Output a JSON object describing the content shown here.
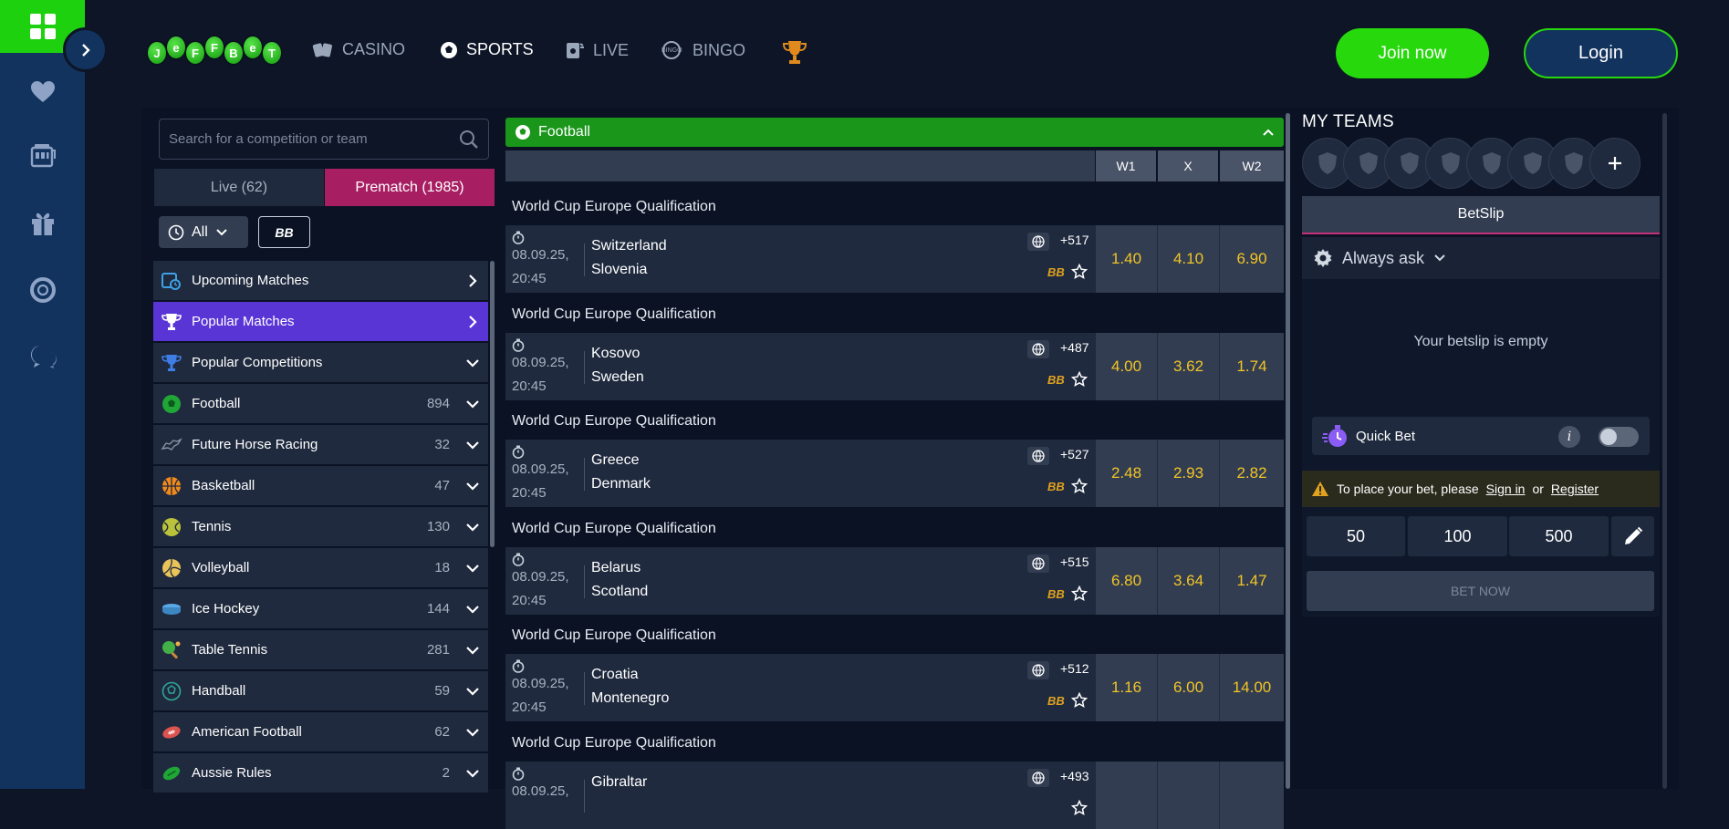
{
  "brand": {
    "logo_letters": [
      "J",
      "e",
      "F",
      "F",
      "B",
      "e",
      "T"
    ]
  },
  "nav": [
    {
      "label": "CASINO",
      "icon": "cards-icon",
      "active": false
    },
    {
      "label": "SPORTS",
      "icon": "soccer-ball-icon",
      "active": true
    },
    {
      "label": "LIVE",
      "icon": "live-icon",
      "active": false
    },
    {
      "label": "BINGO",
      "icon": "bingo-icon",
      "active": false
    },
    {
      "label": "",
      "icon": "trophy-icon",
      "active": false
    }
  ],
  "auth": {
    "join_label": "Join now",
    "login_label": "Login"
  },
  "sidebar": {
    "search_placeholder": "Search for a competition or team",
    "tabs": {
      "live": "Live (62)",
      "prematch": "Prematch (1985)"
    },
    "filter_all": "All",
    "filter_bb": "BB",
    "items": [
      {
        "label": "Upcoming Matches",
        "count": "",
        "icon": "calendar-clock-icon",
        "chevron": "right",
        "active": false
      },
      {
        "label": "Popular Matches",
        "count": "",
        "icon": "trophy-icon",
        "chevron": "right",
        "active": true
      },
      {
        "label": "Popular Competitions",
        "count": "",
        "icon": "cup-icon",
        "chevron": "down",
        "active": false
      },
      {
        "label": "Football",
        "count": "894",
        "icon": "football-icon",
        "chevron": "down",
        "active": false
      },
      {
        "label": "Future Horse Racing",
        "count": "32",
        "icon": "horse-icon",
        "chevron": "down",
        "active": false
      },
      {
        "label": "Basketball",
        "count": "47",
        "icon": "basketball-icon",
        "chevron": "down",
        "active": false
      },
      {
        "label": "Tennis",
        "count": "130",
        "icon": "tennis-icon",
        "chevron": "down",
        "active": false
      },
      {
        "label": "Volleyball",
        "count": "18",
        "icon": "volleyball-icon",
        "chevron": "down",
        "active": false
      },
      {
        "label": "Ice Hockey",
        "count": "144",
        "icon": "puck-icon",
        "chevron": "down",
        "active": false
      },
      {
        "label": "Table Tennis",
        "count": "281",
        "icon": "table-tennis-icon",
        "chevron": "down",
        "active": false
      },
      {
        "label": "Handball",
        "count": "59",
        "icon": "handball-icon",
        "chevron": "down",
        "active": false
      },
      {
        "label": "American Football",
        "count": "62",
        "icon": "american-football-icon",
        "chevron": "down",
        "active": false
      },
      {
        "label": "Aussie Rules",
        "count": "2",
        "icon": "aussie-rules-icon",
        "chevron": "down",
        "active": false
      }
    ]
  },
  "center": {
    "sport": "Football",
    "columns": [
      "W1",
      "X",
      "W2"
    ],
    "matches": [
      {
        "competition": "World Cup Europe Qualification",
        "date": "08.09.25,",
        "time": "20:45",
        "home": "Switzerland",
        "away": "Slovenia",
        "more": "+517",
        "bb": "BB",
        "odds": [
          "1.40",
          "4.10",
          "6.90"
        ]
      },
      {
        "competition": "World Cup Europe Qualification",
        "date": "08.09.25,",
        "time": "20:45",
        "home": "Kosovo",
        "away": "Sweden",
        "more": "+487",
        "bb": "BB",
        "odds": [
          "4.00",
          "3.62",
          "1.74"
        ]
      },
      {
        "competition": "World Cup Europe Qualification",
        "date": "08.09.25,",
        "time": "20:45",
        "home": "Greece",
        "away": "Denmark",
        "more": "+527",
        "bb": "BB",
        "odds": [
          "2.48",
          "2.93",
          "2.82"
        ]
      },
      {
        "competition": "World Cup Europe Qualification",
        "date": "08.09.25,",
        "time": "20:45",
        "home": "Belarus",
        "away": "Scotland",
        "more": "+515",
        "bb": "BB",
        "odds": [
          "6.80",
          "3.64",
          "1.47"
        ]
      },
      {
        "competition": "World Cup Europe Qualification",
        "date": "08.09.25,",
        "time": "20:45",
        "home": "Croatia",
        "away": "Montenegro",
        "more": "+512",
        "bb": "BB",
        "odds": [
          "1.16",
          "6.00",
          "14.00"
        ]
      },
      {
        "competition": "World Cup Europe Qualification",
        "date": "08.09.25,",
        "time": "",
        "home": "Gibraltar",
        "away": "",
        "more": "+493",
        "bb": "",
        "odds": [
          "",
          "",
          ""
        ]
      }
    ]
  },
  "right": {
    "my_teams_title": "MY TEAMS",
    "team_slots": 7,
    "betslip_tab": "BetSlip",
    "always_ask": "Always ask",
    "empty_msg": "Your betslip is empty",
    "quick_bet": "Quick Bet",
    "warn_text": "To place your bet, please",
    "sign_in": "Sign in",
    "or": "or",
    "register": "Register",
    "stakes": [
      "50",
      "100",
      "500"
    ],
    "bet_now": "BET NOW"
  },
  "colors": {
    "brand_green": "#27d80c",
    "rail_blue": "#12335e",
    "prematch_pink": "#a81e63",
    "active_purple": "#5a35d6",
    "odd_yellow": "#f2c524"
  }
}
